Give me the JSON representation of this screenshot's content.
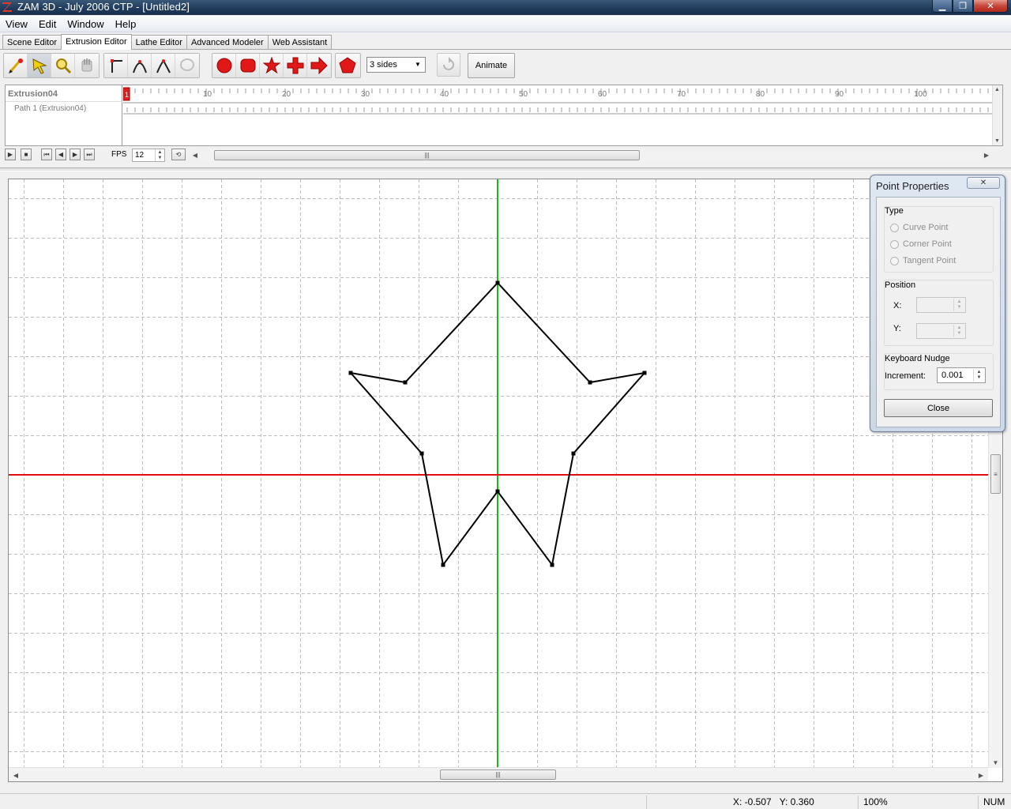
{
  "window": {
    "title": "ZAM 3D - July 2006 CTP - [Untitled2]",
    "icon": "zam3d-logo-icon",
    "controls": [
      "minimize-icon",
      "maximize-icon",
      "close-icon"
    ],
    "close_glyph": "✕",
    "min_glyph": "▁",
    "max_glyph": "❐"
  },
  "menu": [
    {
      "label": "View"
    },
    {
      "label": "Edit"
    },
    {
      "label": "Window"
    },
    {
      "label": "Help"
    }
  ],
  "tabs": [
    {
      "label": "Scene Editor",
      "active": false
    },
    {
      "label": "Extrusion Editor",
      "active": true
    },
    {
      "label": "Lathe Editor",
      "active": false
    },
    {
      "label": "Advanced Modeler",
      "active": false
    },
    {
      "label": "Web Assistant",
      "active": false
    }
  ],
  "toolbar": {
    "edit_tools": [
      "add-point-pen-icon",
      "select-arrow-icon",
      "zoom-magnifier-icon",
      "pan-hand-icon"
    ],
    "point_tools": [
      "corner-point-icon",
      "curve-point-icon",
      "tangent-point-icon",
      "lasso-icon"
    ],
    "shape_tools": [
      "circle-shape-icon",
      "rounded-rect-shape-icon",
      "star-shape-icon",
      "cross-shape-icon",
      "arrow-shape-icon"
    ],
    "polygon_tool": "polygon-shape-icon",
    "sides_value": "3 sides",
    "refresh_icon": "undo-refresh-icon",
    "animate_label": "Animate",
    "accent": "#e02020"
  },
  "timeline": {
    "track_name": "Extrusion04",
    "path_name": "Path 1 (Extrusion04)",
    "current_frame": "1",
    "ruler_labels": [
      "10",
      "20",
      "30",
      "40",
      "50",
      "60",
      "70",
      "80",
      "90",
      "100",
      "1"
    ]
  },
  "playback": {
    "fps_label": "FPS",
    "fps_value": "12"
  },
  "canvas": {
    "x_axis_color": "#e01010",
    "y_axis_color": "#10c010",
    "shape": "star",
    "star_points": [
      [
        0.0,
        0.81
      ],
      [
        0.39,
        0.39
      ],
      [
        0.62,
        0.43
      ],
      [
        0.32,
        0.09
      ],
      [
        0.23,
        -0.38
      ],
      [
        0.0,
        -0.07
      ],
      [
        -0.23,
        -0.38
      ],
      [
        -0.32,
        0.09
      ],
      [
        -0.62,
        0.43
      ],
      [
        -0.39,
        0.39
      ]
    ]
  },
  "point_properties": {
    "title": "Point Properties",
    "type_label": "Type",
    "type_options": [
      "Curve Point",
      "Corner Point",
      "Tangent Point"
    ],
    "position_label": "Position",
    "x_label": "X:",
    "y_label": "Y:",
    "nudge_label": "Keyboard Nudge",
    "increment_label": "Increment:",
    "increment_value": "0.001",
    "close_label": "Close"
  },
  "status": {
    "x_coord": "X: -0.507",
    "y_coord": "Y: 0.360",
    "zoom": "100%",
    "num": "NUM"
  }
}
